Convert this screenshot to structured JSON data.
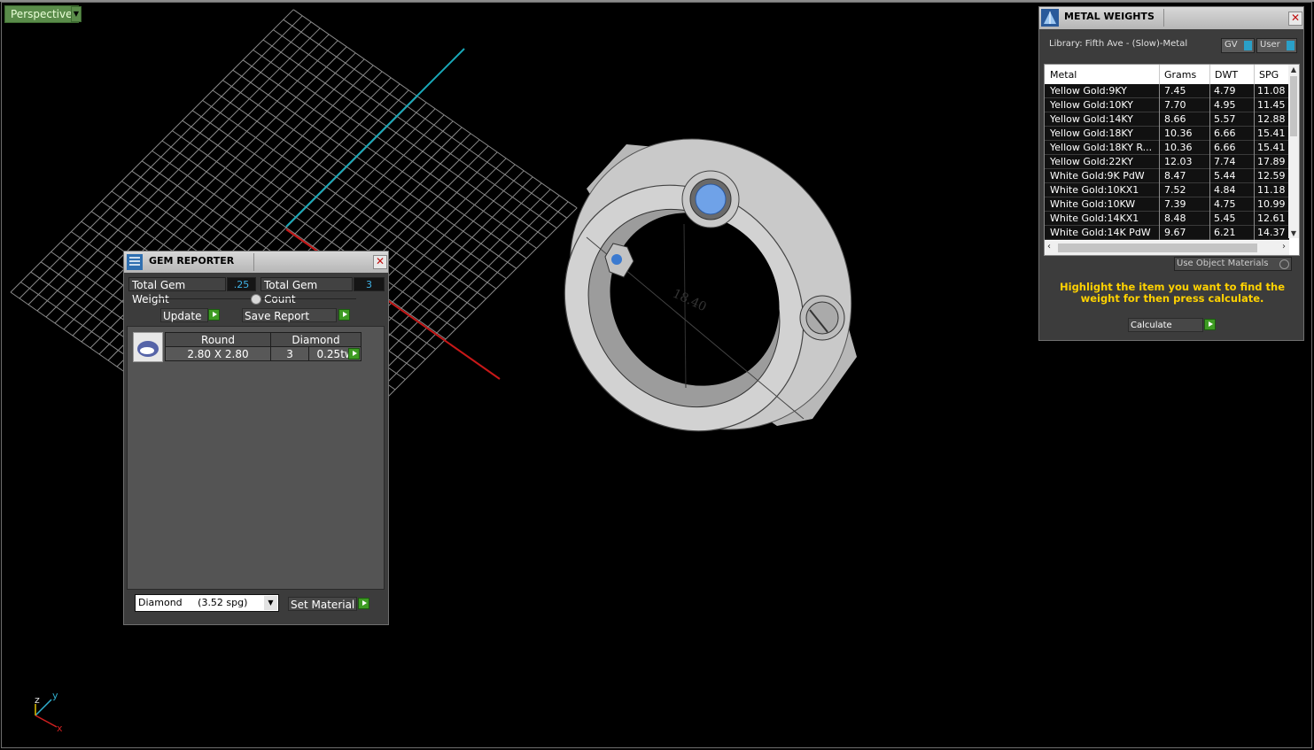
{
  "viewport": {
    "view_label": "Perspective",
    "ring_engraving": "18.40",
    "axis_labels": {
      "x": "x",
      "y": "y",
      "z": "z"
    }
  },
  "gem_reporter": {
    "title": "GEM REPORTER",
    "total_gem_weight_label": "Total Gem Weight",
    "total_gem_weight_value": ".25",
    "total_gem_count_label": "Total Gem Count",
    "total_gem_count_value": "3",
    "update_label": "Update",
    "save_report_label": "Save Report",
    "gems": [
      {
        "shape": "Round",
        "size": "2.80 X 2.80",
        "material": "Diamond",
        "count": "3",
        "weight": "0.25tw"
      }
    ],
    "material_select_value": "Diamond     (3.52 spg)",
    "set_material_label": "Set Material"
  },
  "metal_weights": {
    "title": "METAL WEIGHTS",
    "library": "Library: Fifth Ave - (Slow)-Metal",
    "gv_label": "GV",
    "user_label": "User",
    "columns": [
      "Metal",
      "Grams",
      "DWT",
      "SPG"
    ],
    "rows": [
      [
        "Yellow Gold:9KY",
        "7.45",
        "4.79",
        "11.08"
      ],
      [
        "Yellow Gold:10KY",
        "7.70",
        "4.95",
        "11.45"
      ],
      [
        "Yellow Gold:14KY",
        "8.66",
        "5.57",
        "12.88"
      ],
      [
        "Yellow Gold:18KY",
        "10.36",
        "6.66",
        "15.41"
      ],
      [
        "Yellow Gold:18KY R...",
        "10.36",
        "6.66",
        "15.41"
      ],
      [
        "Yellow Gold:22KY",
        "12.03",
        "7.74",
        "17.89"
      ],
      [
        "White Gold:9K PdW",
        "8.47",
        "5.44",
        "12.59"
      ],
      [
        "White Gold:10KX1",
        "7.52",
        "4.84",
        "11.18"
      ],
      [
        "White Gold:10KW",
        "7.39",
        "4.75",
        "10.99"
      ],
      [
        "White Gold:14KX1",
        "8.48",
        "5.45",
        "12.61"
      ],
      [
        "White Gold:14K PdW",
        "9.67",
        "6.21",
        "14.37"
      ]
    ],
    "use_object_materials_label": "Use Object Materials",
    "hint": "Highlight the item you want to find the weight for then press calculate.",
    "calculate_label": "Calculate"
  }
}
